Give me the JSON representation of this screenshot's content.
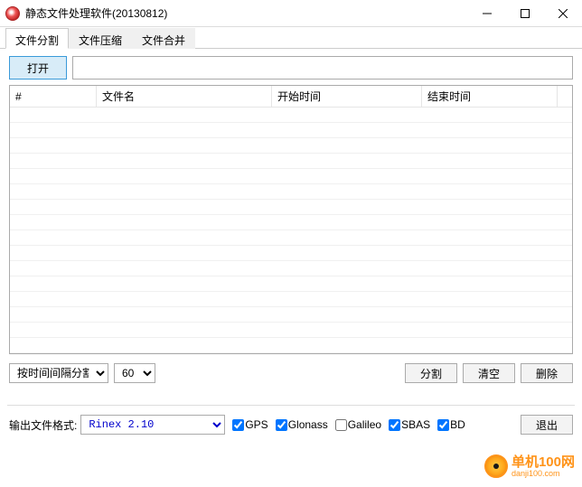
{
  "window": {
    "title": "静态文件处理软件(20130812)"
  },
  "tabs": {
    "split": "文件分割",
    "compress": "文件压缩",
    "merge": "文件合并"
  },
  "toolbar": {
    "open": "打开"
  },
  "table": {
    "col_num": "#",
    "col_name": "文件名",
    "col_start": "开始时间",
    "col_end": "结束时间"
  },
  "controls": {
    "mode_selected": "按时间间隔分割",
    "interval_selected": "60",
    "btn_split": "分割",
    "btn_clear": "清空",
    "btn_delete": "删除"
  },
  "footer": {
    "format_label": "输出文件格式:",
    "format_selected": "Rinex 2.10",
    "chk_gps": "GPS",
    "chk_glonass": "Glonass",
    "chk_galileo": "Galileo",
    "chk_sbas": "SBAS",
    "chk_bd": "BD",
    "btn_exit": "退出"
  },
  "checks": {
    "gps": true,
    "glonass": true,
    "galileo": false,
    "sbas": true,
    "bd": true
  },
  "watermark": {
    "brand": "单机100网",
    "url": "danji100.com"
  }
}
